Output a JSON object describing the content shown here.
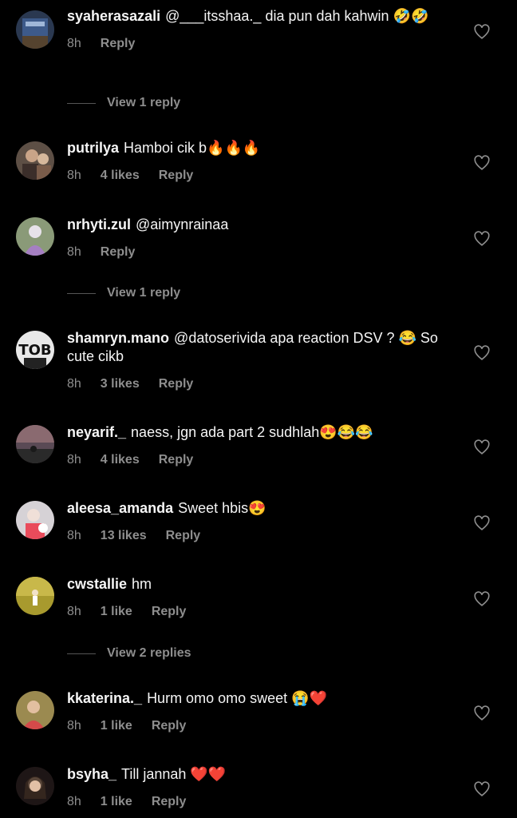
{
  "comments": [
    {
      "user": "syaherasazali",
      "text": "@___itsshaa._  dia pun dah kahwin 🤣🤣",
      "time": "8h",
      "likes": "",
      "reply": "Reply",
      "avatar_color": "#3a4b6a"
    },
    {
      "user": "putrilya",
      "text": "Hamboi cik b🔥🔥🔥",
      "time": "8h",
      "likes": "4 likes",
      "reply": "Reply",
      "avatar_color": "#6b5a4a"
    },
    {
      "user": "nrhyti.zul",
      "text": "@aimynrainaa",
      "time": "8h",
      "likes": "",
      "reply": "Reply",
      "avatar_color": "#7d6b8c"
    },
    {
      "user": "shamryn.mano",
      "text": "@datoserivida apa reaction DSV ? 😂 So cute cikb",
      "time": "8h",
      "likes": "3 likes",
      "reply": "Reply",
      "avatar_color": "#d8d8d8"
    },
    {
      "user": "neyarif._",
      "text": "naess, jgn ada part 2 sudhlah😍😂😂",
      "time": "8h",
      "likes": "4 likes",
      "reply": "Reply",
      "avatar_color": "#4a3a3a"
    },
    {
      "user": "aleesa_amanda",
      "text": "Sweet hbis😍",
      "time": "8h",
      "likes": "13 likes",
      "reply": "Reply",
      "avatar_color": "#c9c3c8"
    },
    {
      "user": "cwstallie",
      "text": "hm",
      "time": "8h",
      "likes": "1 like",
      "reply": "Reply",
      "avatar_color": "#b9a23a"
    },
    {
      "user": "kkaterina._",
      "text": "Hurm omo omo sweet 😭❤️",
      "time": "8h",
      "likes": "1 like",
      "reply": "Reply",
      "avatar_color": "#8a7a4a"
    },
    {
      "user": "bsyha_",
      "text": "Till jannah ❤️❤️",
      "time": "8h",
      "likes": "1 like",
      "reply": "Reply",
      "avatar_color": "#2a2020"
    }
  ],
  "view_replies": [
    "View 1 reply",
    "View 1 reply",
    "View 2 replies"
  ],
  "colors": {
    "background": "#000000",
    "muted": "#8e8e8e",
    "text": "#f5f5f5"
  }
}
